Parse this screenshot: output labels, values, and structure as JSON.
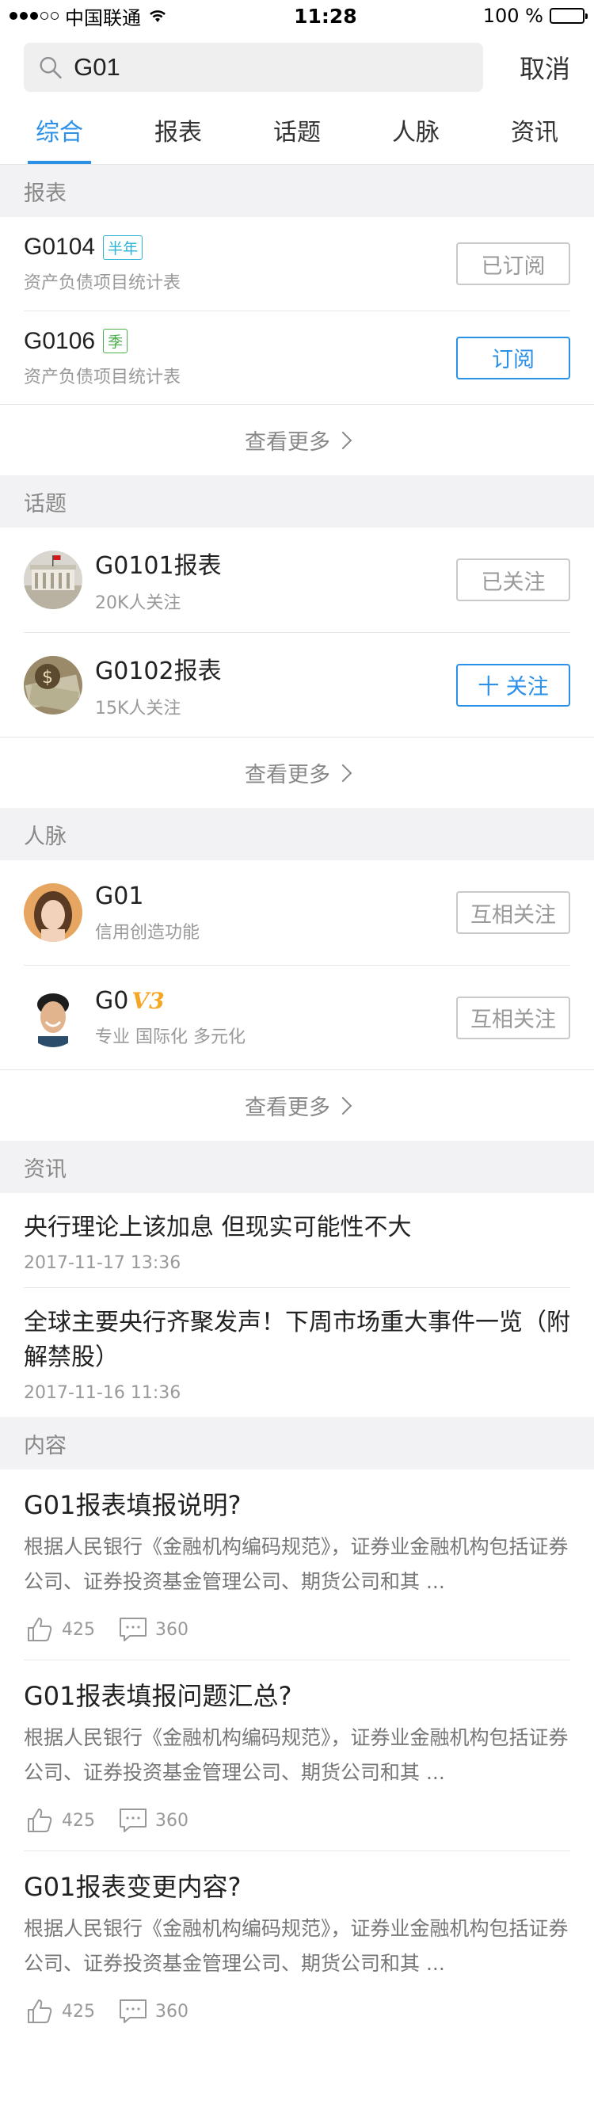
{
  "status": {
    "carrier": "中国联通",
    "time": "11:28",
    "battery": "100 %"
  },
  "search": {
    "value": "G01",
    "cancel": "取消"
  },
  "tabs": [
    "综合",
    "报表",
    "话题",
    "人脉",
    "资讯"
  ],
  "sections": {
    "reports": "报表",
    "topics": "话题",
    "people": "人脉",
    "news": "资讯",
    "content": "内容"
  },
  "reports": [
    {
      "title": "G0104",
      "tag": "半年",
      "sub": "资产负债项目统计表",
      "button": "已订阅"
    },
    {
      "title": "G0106",
      "tag": "季",
      "sub": "资产负债项目统计表",
      "button": "订阅"
    }
  ],
  "topics": [
    {
      "title": "G0101报表",
      "sub": "20K人关注",
      "button": "已关注"
    },
    {
      "title": "G0102报表",
      "sub": "15K人关注",
      "button": "十 关注"
    }
  ],
  "people": [
    {
      "name": "G01",
      "sub": "信用创造功能",
      "button": "互相关注"
    },
    {
      "name": "G0",
      "vip": "V3",
      "sub": "专业 国际化 多元化",
      "button": "互相关注"
    }
  ],
  "more_label": "查看更多",
  "news": [
    {
      "title": "央行理论上该加息 但现实可能性不大",
      "time": "2017-11-17 13:36"
    },
    {
      "title": "全球主要央行齐聚发声！下周市场重大事件一览（附解禁股）",
      "time": "2017-11-16 11:36"
    }
  ],
  "contents": [
    {
      "title": "G01报表填报说明?",
      "body": "根据人民银行《金融机构编码规范》，证券业金融机构包括证券公司、证券投资基金管理公司、期货公司和其 ...",
      "likes": "425",
      "comments": "360"
    },
    {
      "title": "G01报表填报问题汇总?",
      "body": "根据人民银行《金融机构编码规范》，证券业金融机构包括证券公司、证券投资基金管理公司、期货公司和其 ...",
      "likes": "425",
      "comments": "360"
    },
    {
      "title": "G01报表变更内容?",
      "body": "根据人民银行《金融机构编码规范》，证券业金融机构包括证券公司、证券投资基金管理公司、期货公司和其 ...",
      "likes": "425",
      "comments": "360"
    }
  ],
  "colors": {
    "accent": "#2a90e8",
    "section_bg": "#f2f2f4"
  }
}
